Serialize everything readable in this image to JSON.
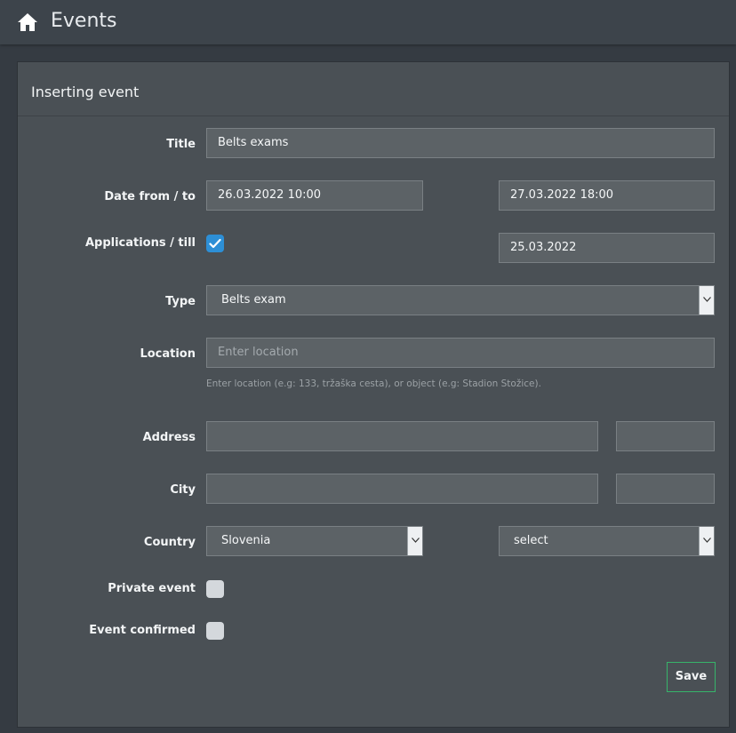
{
  "header": {
    "title": "Events",
    "home_icon": "home-icon"
  },
  "panel": {
    "title": "Inserting event"
  },
  "form": {
    "title": {
      "label": "Title",
      "value": "Belts exams"
    },
    "date": {
      "label": "Date from / to",
      "from": "26.03.2022 10:00",
      "to": "27.03.2022 18:00"
    },
    "applications": {
      "label": "Applications / till",
      "checked": true,
      "till": "25.03.2022"
    },
    "type": {
      "label": "Type",
      "selected": "Belts exam"
    },
    "location": {
      "label": "Location",
      "placeholder": "Enter location",
      "help": "Enter location (e.g: 133, tržaška cesta), or object (e.g: Stadion Stožice)."
    },
    "address": {
      "label": "Address",
      "value": "",
      "number": ""
    },
    "city": {
      "label": "City",
      "value": "",
      "postal": ""
    },
    "country": {
      "label": "Country",
      "selected": "Slovenia",
      "region": "select"
    },
    "private_event": {
      "label": "Private event",
      "checked": false
    },
    "event_confirmed": {
      "label": "Event confirmed",
      "checked": false
    }
  },
  "actions": {
    "save_label": "Save"
  },
  "colors": {
    "accent": "#2d8fd6",
    "save_border": "#37b46a",
    "panel": "#4a5055",
    "background": "#353b42"
  }
}
